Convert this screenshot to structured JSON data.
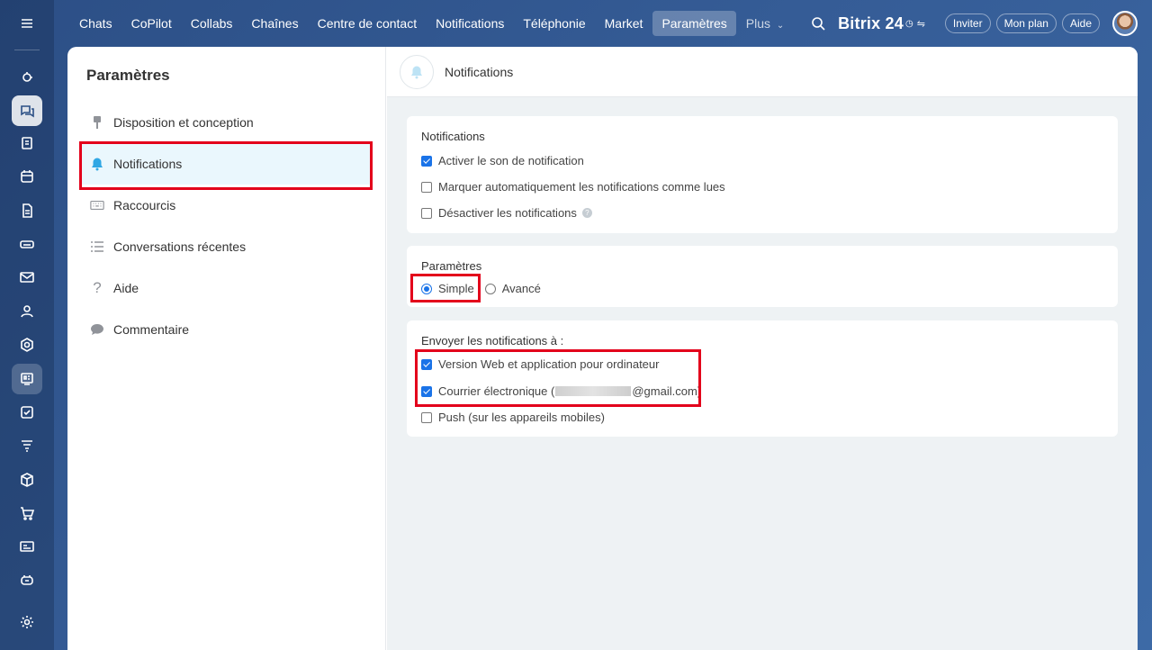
{
  "nav": {
    "items": [
      "Chats",
      "CoPilot",
      "Collabs",
      "Chaînes",
      "Centre de contact",
      "Notifications",
      "Téléphonie",
      "Market",
      "Paramètres"
    ],
    "more": "Plus",
    "brand": "Bitrix 24",
    "invite": "Inviter",
    "plan": "Mon plan",
    "help": "Aide"
  },
  "sidebar": {
    "title": "Paramètres",
    "items": [
      {
        "label": "Disposition et conception",
        "icon": "brush-icon"
      },
      {
        "label": "Notifications",
        "icon": "bell-icon"
      },
      {
        "label": "Raccourcis",
        "icon": "keyboard-icon"
      },
      {
        "label": "Conversations récentes",
        "icon": "list-icon"
      },
      {
        "label": "Aide",
        "icon": "question-icon"
      },
      {
        "label": "Commentaire",
        "icon": "comment-icon"
      }
    ]
  },
  "header": {
    "title": "Notifications"
  },
  "notifications_card": {
    "title": "Notifications",
    "options": [
      {
        "label": "Activer le son de notification",
        "checked": true
      },
      {
        "label": "Marquer automatiquement les notifications comme lues",
        "checked": false
      },
      {
        "label": "Désactiver les notifications",
        "checked": false
      }
    ]
  },
  "mode_card": {
    "title": "Paramètres",
    "simple": "Simple",
    "advanced": "Avancé",
    "selected": "Simple"
  },
  "send_card": {
    "title": "Envoyer les notifications à :",
    "web": "Version Web et application pour ordinateur",
    "email_prefix": "Courrier électronique (",
    "email_suffix": "@gmail.com)",
    "push": "Push (sur les appareils mobiles)",
    "web_checked": true,
    "email_checked": true,
    "push_checked": false
  },
  "colors": {
    "accent": "#1a73e8",
    "highlight": "#e3001b",
    "active_bg": "#eaf7fd"
  }
}
